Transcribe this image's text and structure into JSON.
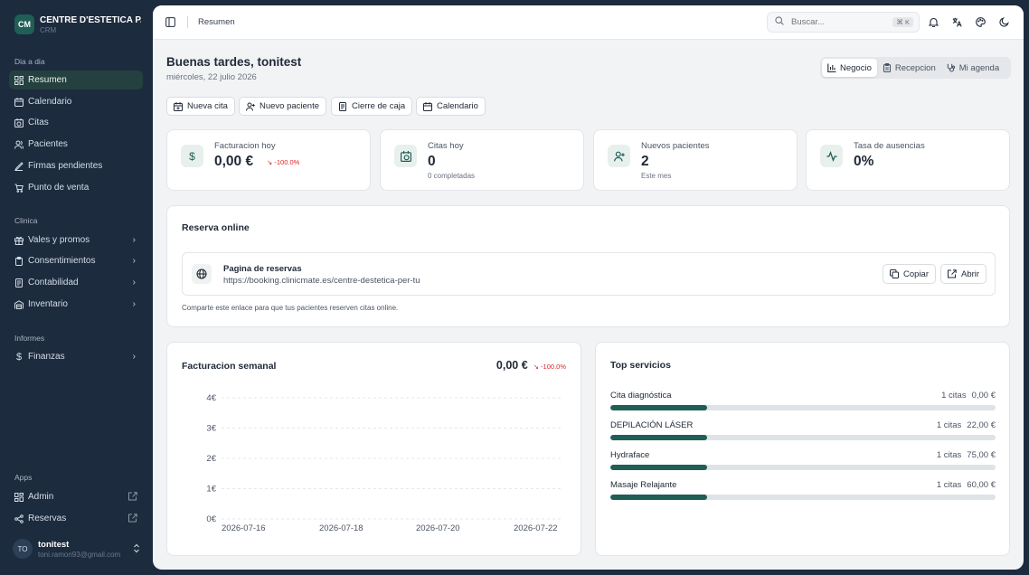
{
  "brand": {
    "initials": "CM",
    "name": "CENTRE D'ESTETICA P...",
    "sub": "CRM"
  },
  "sidebar": {
    "sections": [
      "Dia a dia",
      "Clinica",
      "Informes",
      "Apps"
    ],
    "day": [
      {
        "label": "Resumen",
        "icon": "dashboard-icon"
      },
      {
        "label": "Calendario",
        "icon": "calendar-icon"
      },
      {
        "label": "Citas",
        "icon": "calendar-clock-icon"
      },
      {
        "label": "Pacientes",
        "icon": "users-icon"
      },
      {
        "label": "Firmas pendientes",
        "icon": "signature-icon"
      },
      {
        "label": "Punto de venta",
        "icon": "cart-icon"
      }
    ],
    "clinic": [
      {
        "label": "Vales y promos",
        "icon": "gift-icon"
      },
      {
        "label": "Consentimientos",
        "icon": "clipboard-icon"
      },
      {
        "label": "Contabilidad",
        "icon": "ledger-icon"
      },
      {
        "label": "Inventario",
        "icon": "warehouse-icon"
      }
    ],
    "reports": [
      {
        "label": "Finanzas",
        "icon": "dollar-icon"
      }
    ],
    "apps": [
      {
        "label": "Admin",
        "icon": "dashboard-icon"
      },
      {
        "label": "Reservas",
        "icon": "share-icon"
      }
    ]
  },
  "user": {
    "initials": "TO",
    "name": "tonitest",
    "email": "toni.ramon93@gmail.com"
  },
  "topbar": {
    "breadcrumb": "Resumen",
    "search_placeholder": "Buscar...",
    "search_shortcut": "⌘ K"
  },
  "header": {
    "greeting": "Buenas tardes, tonitest",
    "date": "miércoles, 22 julio 2026"
  },
  "views": [
    {
      "label": "Negocio",
      "active": true
    },
    {
      "label": "Recepcion",
      "active": false
    },
    {
      "label": "Mi agenda",
      "active": false
    }
  ],
  "actions": [
    "Nueva cita",
    "Nuevo paciente",
    "Cierre de caja",
    "Calendario"
  ],
  "stats": [
    {
      "label": "Facturacion hoy",
      "value": "0,00 €",
      "trend": "↘ -100.0%",
      "sub": ""
    },
    {
      "label": "Citas hoy",
      "value": "0",
      "trend": "",
      "sub": "0 completadas"
    },
    {
      "label": "Nuevos pacientes",
      "value": "2",
      "trend": "",
      "sub": "Este mes"
    },
    {
      "label": "Tasa de ausencias",
      "value": "0%",
      "trend": "",
      "sub": ""
    }
  ],
  "booking": {
    "title": "Reserva online",
    "page_title": "Pagina de reservas",
    "url": "https://booking.clinicmate.es/centre-destetica-per-tu",
    "copy_label": "Copiar",
    "open_label": "Abrir",
    "hint": "Comparte este enlace para que tus pacientes reserven citas online."
  },
  "weekly": {
    "title": "Facturacion semanal",
    "total": "0,00 €",
    "trend": "↘ -100.0%"
  },
  "chart_data": {
    "type": "line",
    "title": "Facturacion semanal",
    "x": [
      "2026-07-16",
      "2026-07-18",
      "2026-07-20",
      "2026-07-22"
    ],
    "y_ticks": [
      "0€",
      "1€",
      "2€",
      "3€",
      "4€"
    ],
    "ylim": [
      0,
      4
    ],
    "grid": true,
    "series": []
  },
  "top_services": {
    "title": "Top servicios",
    "items": [
      {
        "name": "Cita diagnóstica",
        "count": "1 citas",
        "amount": "0,00 €",
        "share": 0.25
      },
      {
        "name": "DEPILACIÓN LÁSER",
        "count": "1 citas",
        "amount": "22,00 €",
        "share": 0.25
      },
      {
        "name": "Hydraface",
        "count": "1 citas",
        "amount": "75,00 €",
        "share": 0.25
      },
      {
        "name": "Masaje Relajante",
        "count": "1 citas",
        "amount": "60,00 €",
        "share": 0.25
      }
    ]
  },
  "colors": {
    "accent": "#1f5f56",
    "sidebar": "#1d2b3e",
    "negative": "#dc2626"
  }
}
